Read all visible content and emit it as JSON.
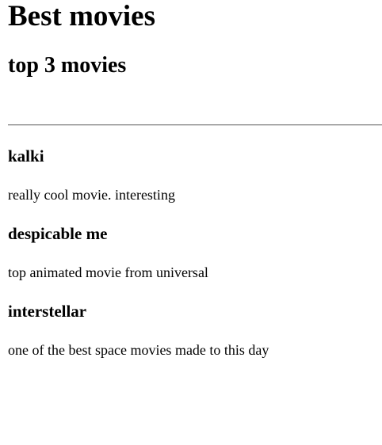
{
  "page": {
    "title": "Best movies",
    "subtitle": "top 3 movies"
  },
  "movies": [
    {
      "name": "kalki",
      "description": "really cool movie. interesting"
    },
    {
      "name": "despicable me",
      "description": "top animated movie from universal"
    },
    {
      "name": "interstellar",
      "description": "one of the best space movies made to this day"
    }
  ]
}
